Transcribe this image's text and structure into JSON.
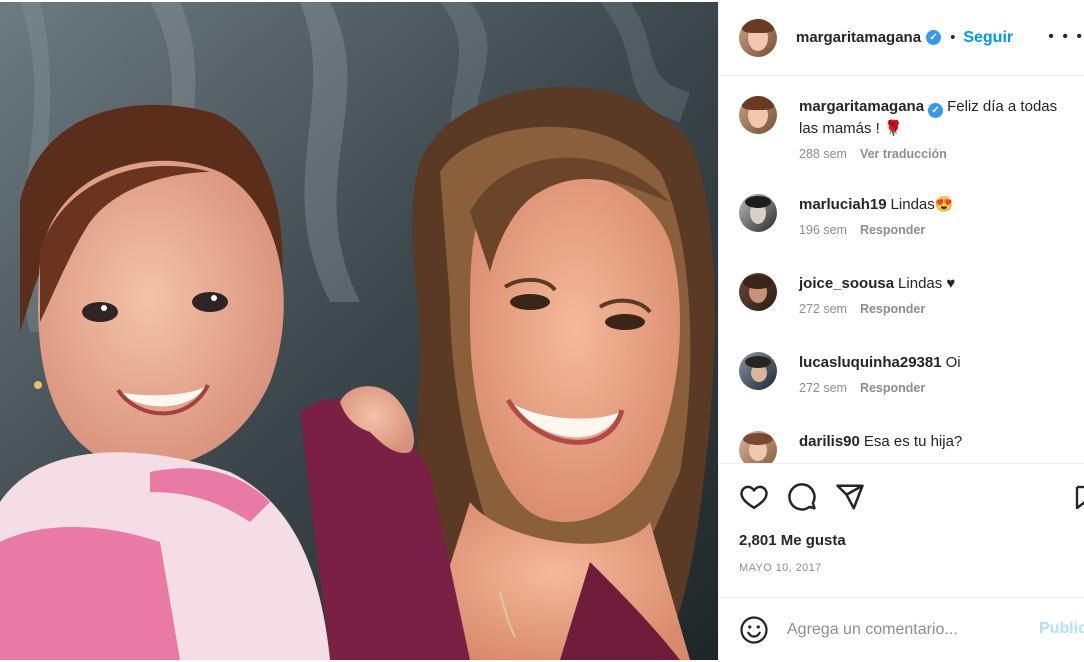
{
  "post": {
    "photo_alt": "",
    "author": {
      "username": "margaritamagana",
      "verified": true,
      "follow_label": "Seguir",
      "separator": "•",
      "more_label": "• • •"
    },
    "caption": {
      "username": "margaritamagana",
      "text": "Feliz día a todas las mamás ! 🌹",
      "time": "288 sem",
      "translate_label": "Ver traducción"
    },
    "comments": [
      {
        "username": "marluciah19",
        "text": "Lindas😍",
        "time": "196 sem",
        "reply_label": "Responder"
      },
      {
        "username": "joice_soousa",
        "text": "Lindas ♥",
        "time": "272 sem",
        "reply_label": "Responder"
      },
      {
        "username": "lucasluquinha29381",
        "text": "Oi",
        "time": "272 sem",
        "reply_label": "Responder"
      },
      {
        "username": "darilis90",
        "text": "Esa es tu hija?",
        "time": "",
        "reply_label": ""
      }
    ],
    "likes": "2,801 Me gusta",
    "date": "MAYO 10, 2017",
    "add_comment": {
      "placeholder": "Agrega un comentario...",
      "publish_label": "Publicar"
    },
    "icons": [
      "like-icon",
      "comment-icon",
      "share-icon",
      "bookmark-icon",
      "emoji-icon"
    ],
    "colors": {
      "accent": "#0095f6",
      "publish_disabled": "#b2dffc",
      "verified": "#3897f0",
      "muted": "#8e8e8e"
    }
  }
}
